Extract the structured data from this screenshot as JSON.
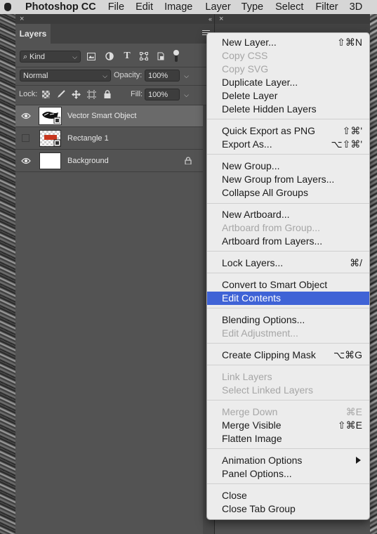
{
  "menubar": {
    "app_name": "Photoshop CC",
    "items": [
      "File",
      "Edit",
      "Image",
      "Layer",
      "Type",
      "Select",
      "Filter",
      "3D"
    ]
  },
  "layers_panel": {
    "close_glyph": "×",
    "collapse_glyph": "‹‹",
    "tab_label": "Layers",
    "filter_kind": "Kind",
    "blend_mode": "Normal",
    "opacity_label": "Opacity:",
    "opacity_value": "100%",
    "lock_label": "Lock:",
    "fill_label": "Fill:",
    "fill_value": "100%",
    "layers": [
      {
        "name": "Vector Smart Object",
        "visible": true,
        "selected": true
      },
      {
        "name": "Rectangle 1",
        "visible": false,
        "selected": false
      },
      {
        "name": "Background",
        "visible": true,
        "selected": false,
        "locked": true
      }
    ]
  },
  "second_panel": {
    "close_glyph": "×"
  },
  "context_menu": {
    "items": [
      {
        "label": "New Layer...",
        "shortcut": "⇧⌘N"
      },
      {
        "label": "Copy CSS",
        "disabled": true
      },
      {
        "label": "Copy SVG",
        "disabled": true
      },
      {
        "label": "Duplicate Layer..."
      },
      {
        "label": "Delete Layer"
      },
      {
        "label": "Delete Hidden Layers"
      },
      {
        "label": "Quick Export as PNG",
        "shortcut": "⇧⌘'"
      },
      {
        "label": "Export As...",
        "shortcut": "⌥⇧⌘'"
      },
      {
        "label": "New Group..."
      },
      {
        "label": "New Group from Layers..."
      },
      {
        "label": "Collapse All Groups"
      },
      {
        "label": "New Artboard..."
      },
      {
        "label": "Artboard from Group...",
        "disabled": true
      },
      {
        "label": "Artboard from Layers..."
      },
      {
        "label": "Lock Layers...",
        "shortcut": "⌘/"
      },
      {
        "label": "Convert to Smart Object"
      },
      {
        "label": "Edit Contents",
        "highlighted": true
      },
      {
        "label": "Blending Options..."
      },
      {
        "label": "Edit Adjustment...",
        "disabled": true
      },
      {
        "label": "Create Clipping Mask",
        "shortcut": "⌥⌘G"
      },
      {
        "label": "Link Layers",
        "disabled": true
      },
      {
        "label": "Select Linked Layers",
        "disabled": true
      },
      {
        "label": "Merge Down",
        "shortcut": "⌘E",
        "disabled": true
      },
      {
        "label": "Merge Visible",
        "shortcut": "⇧⌘E"
      },
      {
        "label": "Flatten Image"
      },
      {
        "label": "Animation Options",
        "submenu": true
      },
      {
        "label": "Panel Options..."
      },
      {
        "label": "Close"
      },
      {
        "label": "Close Tab Group"
      }
    ]
  },
  "colors": {
    "highlight": "#3f63d6",
    "menu_bg": "#ececec",
    "panel_bg": "#535353"
  }
}
